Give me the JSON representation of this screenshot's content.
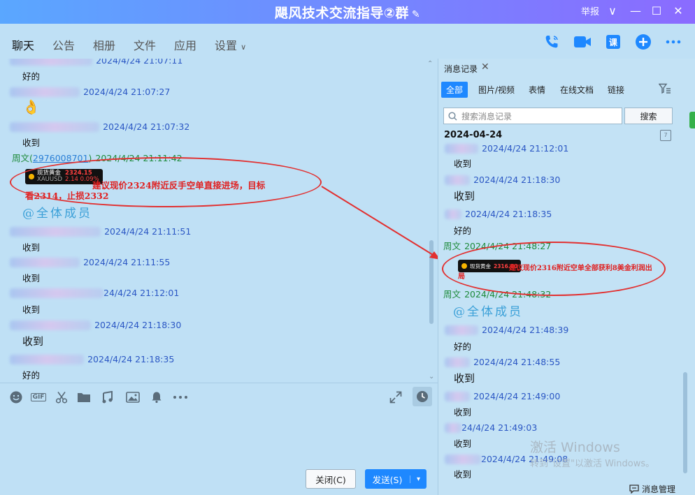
{
  "window": {
    "title": "飓风技术交流指导②群",
    "report": "举报",
    "controls": {
      "dropdown": "∨",
      "minimize": "—",
      "maximize": "☐",
      "close": "✕"
    }
  },
  "nav": {
    "tabs": [
      "聊天",
      "公告",
      "相册",
      "文件",
      "应用",
      "设置"
    ],
    "settings_caret": "∨",
    "course_label": "课"
  },
  "chat": {
    "messages": [
      {
        "time": "2024/4/24 21:07:11",
        "content": "好的"
      },
      {
        "time": "2024/4/24 21:07:27",
        "content": "👌"
      },
      {
        "time": "2024/4/24 21:07:32",
        "content": "收到"
      },
      {
        "sender": "周文",
        "qq": "2976008701",
        "time": "2024/4/24 21:11:42"
      },
      {
        "time": "2024/4/24 21:11:51",
        "content": "收到"
      },
      {
        "time": "2024/4/24 21:11:55",
        "content": "收到"
      },
      {
        "time": "24/4/24 21:12:01",
        "content": "收到"
      },
      {
        "time": "2024/4/24 21:18:30",
        "content": "收到"
      },
      {
        "time": "2024/4/24 21:18:35",
        "content": "好的"
      }
    ],
    "trade_call": {
      "widget_name": "现货黄金",
      "widget_price": "2324.15",
      "widget_code": "XAUUSD",
      "widget_change": "2.14  0.09%",
      "text_line1": "建议现价2324附近反手空单直接进场，目标",
      "text_line2": "看2314，止损2332",
      "at_all": "@全体成员"
    }
  },
  "toolbar": {
    "gif_label": "GIF"
  },
  "buttons": {
    "close": "关闭(C)",
    "send": "发送(S)",
    "send_arrow": "▾"
  },
  "history": {
    "tab_label": "消息记录",
    "tab_close": "✕",
    "filters": [
      "全部",
      "图片/视频",
      "表情",
      "在线文档",
      "链接"
    ],
    "search_placeholder": "搜索消息记录",
    "search_button": "搜索",
    "date_header": "2024-04-24",
    "calendar_label": "7",
    "messages": [
      {
        "time": "2024/4/24 21:12:01",
        "content": "收到"
      },
      {
        "time": "2024/4/24 21:18:30",
        "content": "收到"
      },
      {
        "time": "2024/4/24 21:18:35",
        "content": "好的"
      },
      {
        "sender": "周文",
        "time": "2024/4/24 21:48:27"
      },
      {
        "sender": "周文",
        "time": "2024/4/24 21:48:32"
      },
      {
        "time": "2024/4/24 21:48:39",
        "content": "好的"
      },
      {
        "time": "2024/4/24 21:48:55",
        "content": "收到"
      },
      {
        "time": "2024/4/24 21:49:00",
        "content": "收到"
      },
      {
        "time": "24/4/24 21:49:03",
        "content": "收到"
      },
      {
        "time": "2024/4/24 21:49:08",
        "content": "收到"
      }
    ],
    "trade_call": {
      "widget_name": "现货黄金",
      "widget_price": "2316.80",
      "text_line1": "建议现价2316附近空单全部获利8美金利润出",
      "text_line2": "局"
    },
    "at_all": "@全体成员",
    "message_manager": "消息管理"
  },
  "watermark": {
    "line1": "激活 Windows",
    "line2": "转到\"设置\"以激活 Windows。"
  }
}
